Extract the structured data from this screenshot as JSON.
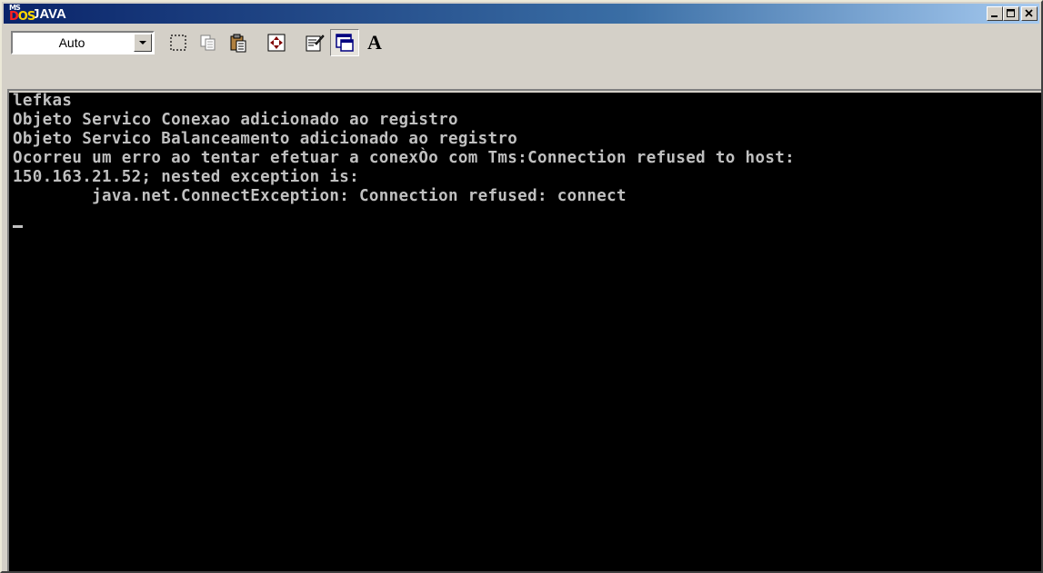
{
  "window": {
    "title": "JAVA",
    "icon_ms": "MS",
    "icon_dos_d": "D",
    "icon_dos_o": "OS",
    "controls": {
      "minimize": "_",
      "maximize": "□",
      "close": "✕"
    }
  },
  "toolbar": {
    "font_size_value": "Auto",
    "buttons": [
      "mark-icon",
      "copy-icon",
      "paste-icon",
      "fullscreen-icon",
      "properties-icon",
      "background-icon",
      "font-icon"
    ],
    "font_button_label": "A"
  },
  "console": {
    "lines": [
      "lefkas",
      "Objeto Servico Conexao adicionado ao registro",
      "Objeto Servico Balanceamento adicionado ao registro",
      "Ocorreu um erro ao tentar efetuar a conexÒo com Tms:Connection refused to host:",
      "150.163.21.52; nested exception is:",
      "        java.net.ConnectException: Connection refused: connect"
    ],
    "text_color": "#c0c0c0",
    "background": "#000000"
  }
}
